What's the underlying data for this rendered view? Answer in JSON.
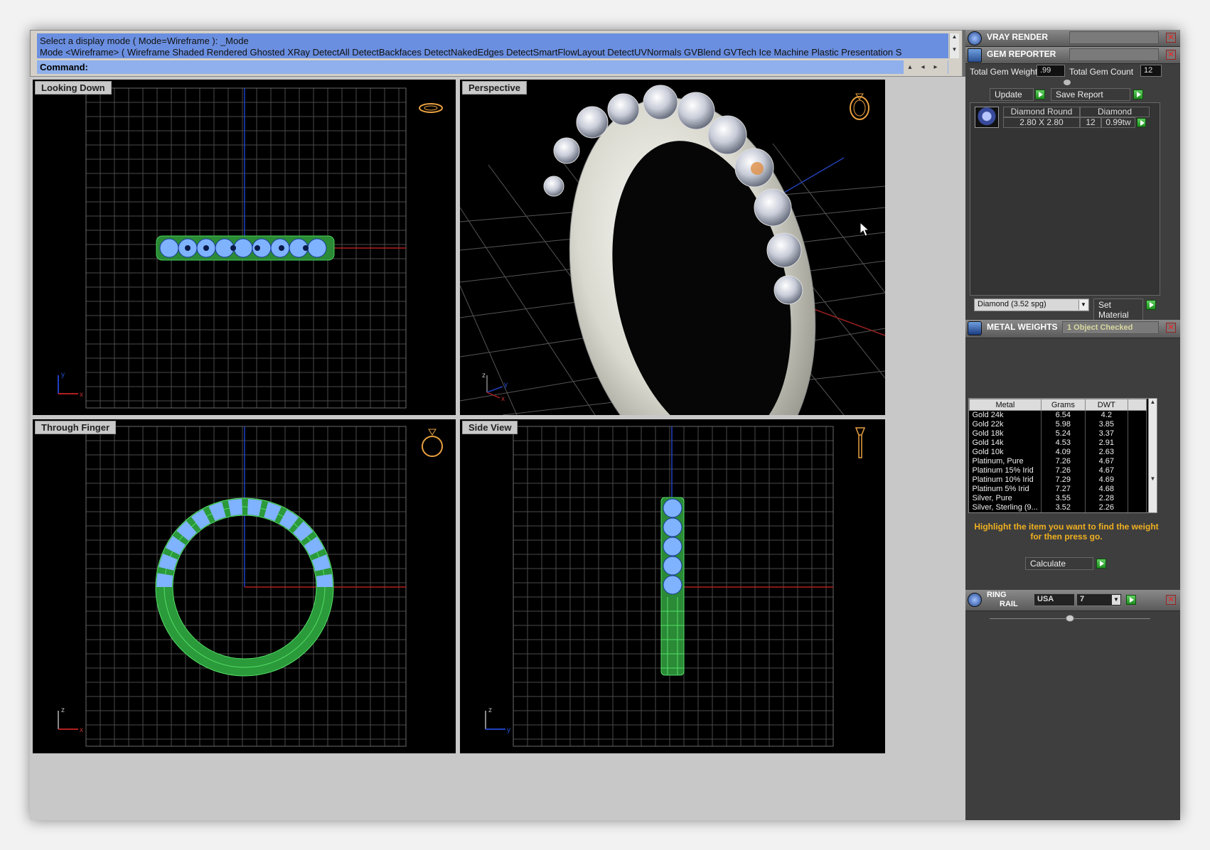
{
  "command": {
    "history": [
      "Select a display mode ( Mode=Wireframe ): _Mode",
      "Mode <Wireframe> ( Wireframe  Shaded  Rendered  Ghosted  XRay  DetectAll  DetectBackfaces  DetectNakedEdges  DetectSmartFlowLayout  DetectUVNormals  GVBlend  GVTech  Ice  Machine  Plastic  Presentation  S"
    ],
    "prompt": "Command:"
  },
  "viewports": {
    "top_left": "Looking Down",
    "top_right": "Perspective",
    "bottom_left": "Through Finger",
    "bottom_right": "Side View"
  },
  "axis_labels": {
    "x": "x",
    "y": "y",
    "z": "z"
  },
  "panel": {
    "vray": {
      "title": "VRAY RENDER"
    },
    "gem_reporter": {
      "title": "GEM REPORTER",
      "total_weight_label": "Total Gem Weight",
      "total_weight": ".99",
      "total_count_label": "Total Gem Count",
      "total_count": "12",
      "update_label": "Update",
      "save_label": "Save Report",
      "gem": {
        "name": "Diamond Round",
        "type": "Diamond",
        "size": "2.80 X 2.80",
        "count": "12",
        "weight": "0.99tw"
      },
      "material_select": "Diamond    (3.52 spg)",
      "set_material_label": "Set Material"
    },
    "metal_weights": {
      "title": "METAL WEIGHTS",
      "status": "1 Object Checked",
      "columns": [
        "Metal",
        "Grams",
        "DWT"
      ],
      "rows": [
        [
          "Gold 24k",
          "6.54",
          "4.2"
        ],
        [
          "Gold 22k",
          "5.98",
          "3.85"
        ],
        [
          "Gold 18k",
          "5.24",
          "3.37"
        ],
        [
          "Gold 14k",
          "4.53",
          "2.91"
        ],
        [
          "Gold 10k",
          "4.09",
          "2.63"
        ],
        [
          "Platinum, Pure",
          "7.26",
          "4.67"
        ],
        [
          "Platinum 15% Irid",
          "7.26",
          "4.67"
        ],
        [
          "Platinum 10% Irid",
          "7.29",
          "4.69"
        ],
        [
          "Platinum 5% Irid",
          "7.27",
          "4.68"
        ],
        [
          "Silver, Pure",
          "3.55",
          "2.28"
        ],
        [
          "Silver, Sterling (9...",
          "3.52",
          "2.26"
        ]
      ],
      "hint": "Highlight the item you want to find the weight for then press go.",
      "calculate_label": "Calculate"
    },
    "ring_rail": {
      "title_line1": "RING",
      "title_line2": "RAIL",
      "region": "USA",
      "size": "7"
    }
  },
  "colors": {
    "grid": "#5c5c5c",
    "x_axis": "#b02020",
    "y_axis": "#2040c0",
    "wire_green": "#30c040",
    "gem_blue": "#7fb2ff",
    "metal_white": "#e8e8e0",
    "accent_hint": "#f0b020"
  }
}
